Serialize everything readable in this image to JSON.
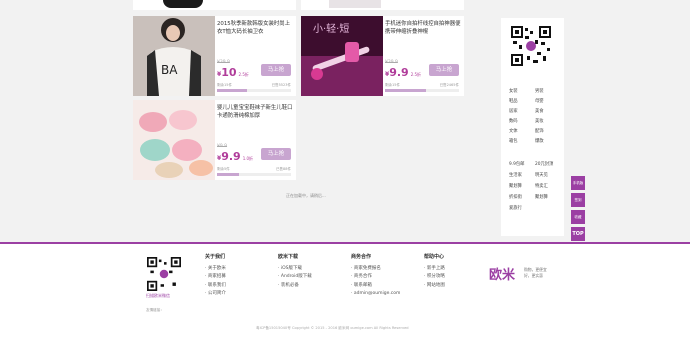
{
  "products": [
    {
      "title": "2015秋季新款韩版女装时尚上衣T恤大码长袖卫衣",
      "old_price": "¥39.9",
      "price": "10",
      "discount": "2.5折",
      "buy": "马上抢",
      "sold": "已售5523件",
      "remain": "剩余15件",
      "progress": 0.4
    },
    {
      "title": "手机迷你自拍杆线控自拍神器便携带伸缩折叠神棍",
      "old_price": "¥39.9",
      "price": "9.9",
      "discount": "2.5折",
      "buy": "马上抢",
      "sold": "已售2465件",
      "remain": "剩余15件",
      "progress": 0.55
    },
    {
      "title": "婴儿儿童宝宝鞋袜子新生儿鞋口卡通防滑纯棉加厚",
      "old_price": "¥9.9",
      "price": "9.9",
      "discount": "1.0折",
      "buy": "马上抢",
      "sold": "已售88件",
      "remain": "剩余5件",
      "progress": 0.3
    }
  ],
  "image_text": {
    "selfie_banner": "小·轻·短"
  },
  "more_text": "正在加载中，请稍后...",
  "sidebar": {
    "categories": [
      "女装",
      "男装",
      "鞋品",
      "母婴",
      "居家",
      "美食",
      "数码",
      "美妆",
      "文体",
      "配饰",
      "箱包",
      "爆款",
      "9.9包邮",
      "20元封顶",
      "生活家",
      "明天见",
      "聚划算",
      "特卖汇",
      "折扣街",
      "聚划算",
      "爱旅行"
    ]
  },
  "float_buttons": [
    "手机版",
    "签到",
    "收藏",
    "TOP"
  ],
  "footer": {
    "qr_caption": "扫描欧米微信",
    "columns": [
      {
        "title": "关于我们",
        "items": [
          "关于欧米",
          "商家招募",
          "联系我们",
          "公司简介"
        ]
      },
      {
        "title": "欧米下载",
        "items": [
          "iOS版下载",
          "Android版下载",
          "装机必备"
        ]
      },
      {
        "title": "商务合作",
        "items": [
          "商家免费报名",
          "商务合作",
          "联系邮箱",
          "admin@oumige.com"
        ]
      },
      {
        "title": "帮助中心",
        "items": [
          "新手上路",
          "积分攻略",
          "网站地图"
        ]
      }
    ],
    "logo": "欧米",
    "slogan": [
      "购物，更便宜",
      "好，更实惠"
    ],
    "links_label": "友情链接：",
    "copyright": "粤ICP备15015040号    Copyright © 2015 - 2016 欧米网 oumige.com All Rights Reserved"
  }
}
